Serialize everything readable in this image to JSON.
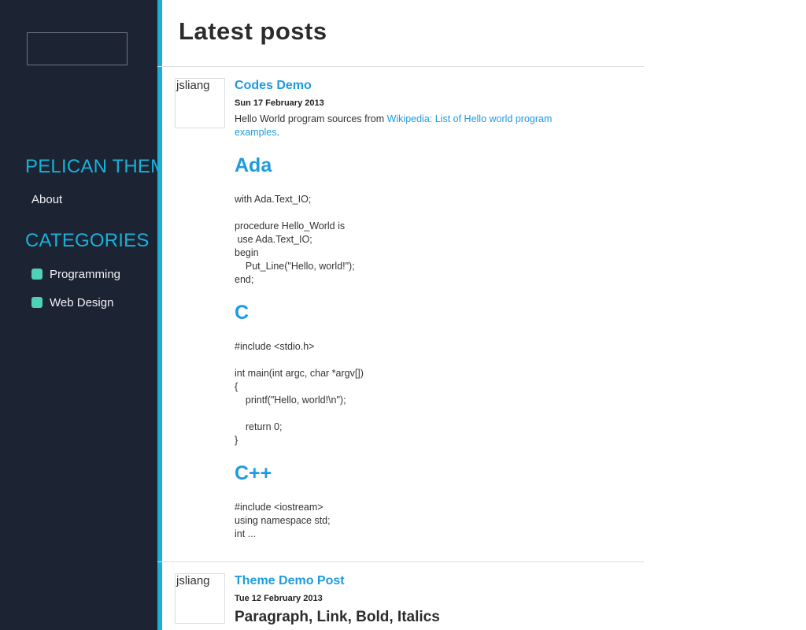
{
  "sidebar": {
    "site_heading": "PELICAN THEME",
    "pages": [
      {
        "label": "About"
      }
    ],
    "categories_heading": "CATEGORIES",
    "categories": [
      {
        "label": "Programming"
      },
      {
        "label": "Web Design"
      }
    ],
    "category_color": "#4fd1b8",
    "accent_color": "#1ab0d8"
  },
  "main": {
    "title": "Latest posts",
    "posts": [
      {
        "author": "jsliang",
        "title": "Codes Demo",
        "date": "Sun 17 February 2013",
        "intro_text": "Hello World program sources from ",
        "intro_link": "Wikipedia: List of Hello world program examples",
        "intro_end": ".",
        "sections": [
          {
            "heading": "Ada",
            "code": "with Ada.Text_IO;\n\nprocedure Hello_World is\n use Ada.Text_IO;\nbegin\n    Put_Line(\"Hello, world!\");\nend;"
          },
          {
            "heading": "C",
            "code": "#include <stdio.h>\n\nint main(int argc, char *argv[])\n{\n    printf(\"Hello, world!\\n\");\n\n    return 0;\n}"
          },
          {
            "heading": "C++",
            "code": "#include <iostream>\nusing namespace std;\nint ..."
          }
        ]
      },
      {
        "author": "jsliang",
        "title": "Theme Demo Post",
        "date": "Tue 12 February 2013",
        "first_heading": "Paragraph, Link, Bold, Italics"
      }
    ]
  }
}
